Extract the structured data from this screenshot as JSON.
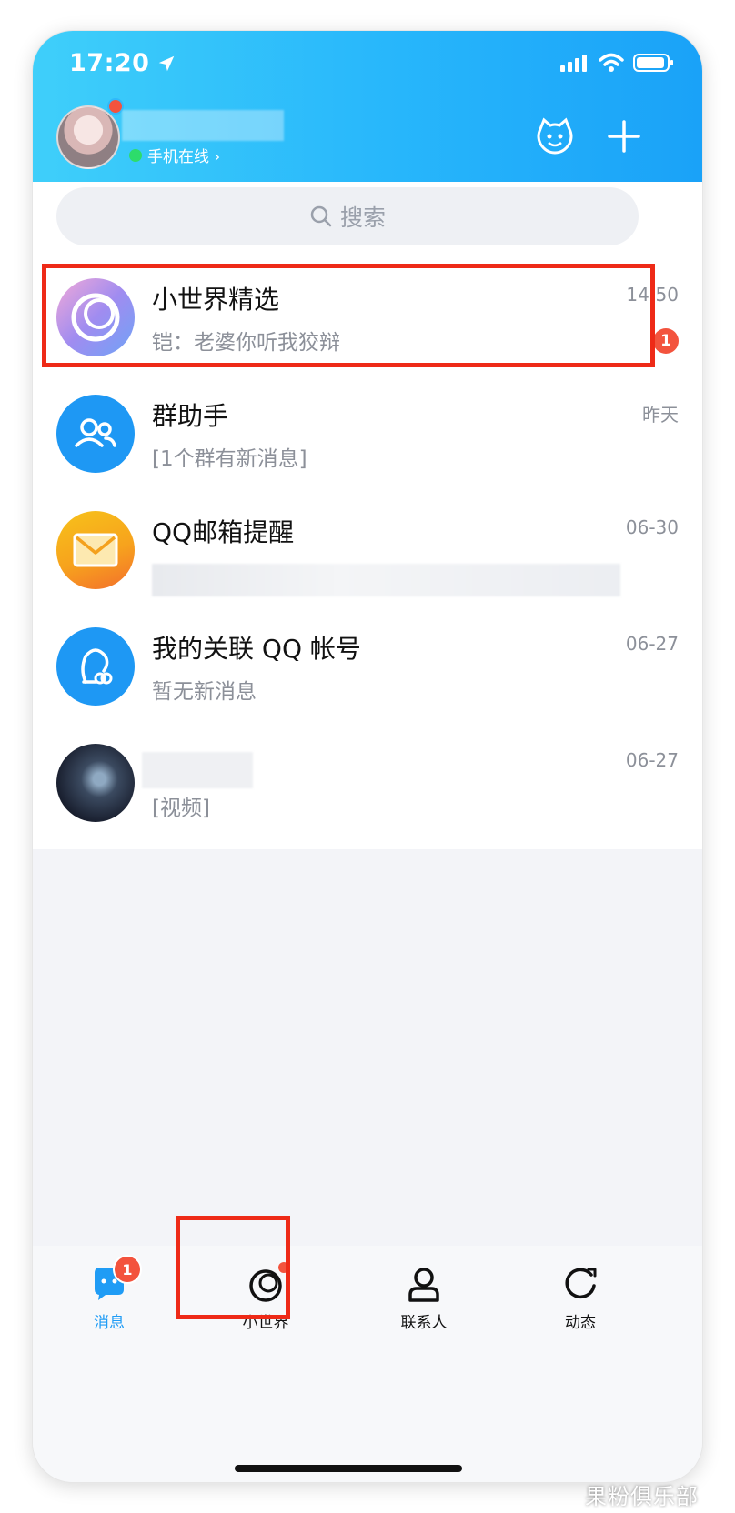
{
  "status_bar": {
    "time": "17:20"
  },
  "header": {
    "online_status": "手机在线 ›"
  },
  "search": {
    "placeholder": "搜索"
  },
  "conversations": [
    {
      "title": "小世界精选",
      "preview": "铠：老婆你听我狡辩",
      "time": "14:50",
      "unread": "1"
    },
    {
      "title": "群助手",
      "preview": "[1个群有新消息]",
      "time": "昨天"
    },
    {
      "title": "QQ邮箱提醒",
      "preview": "",
      "time": "06-30"
    },
    {
      "title": "我的关联 QQ 帐号",
      "preview": "暂无新消息",
      "time": "06-27"
    },
    {
      "title": "",
      "preview": "[视频]",
      "time": "06-27"
    }
  ],
  "tabbar": {
    "tabs": [
      {
        "label": "消息",
        "badge": "1",
        "active": true
      },
      {
        "label": "小世界"
      },
      {
        "label": "联系人"
      },
      {
        "label": "动态"
      }
    ]
  },
  "watermark": "果粉俱乐部",
  "colors": {
    "header_start": "#3fcffa",
    "header_end": "#1aa2f8",
    "accent": "#1f9cf5",
    "badge": "#f3533d",
    "highlight": "#ee2a17"
  }
}
